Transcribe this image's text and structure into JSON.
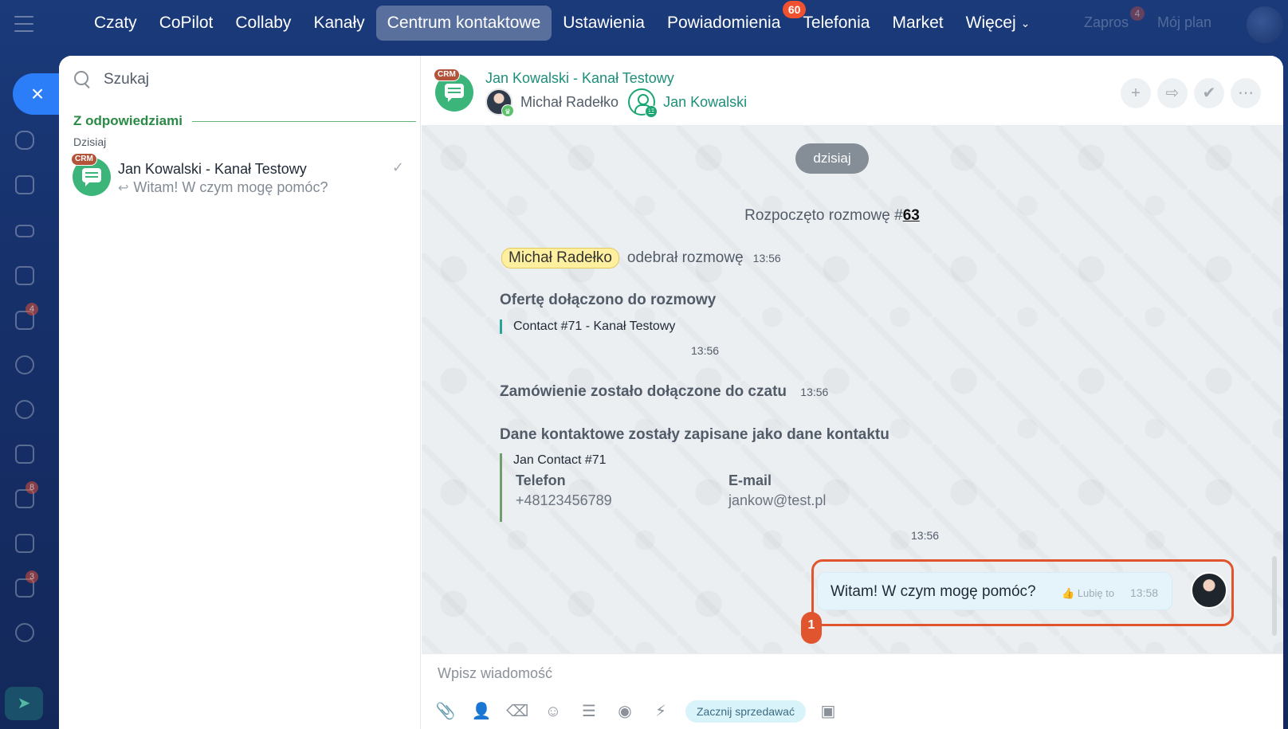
{
  "topnav": {
    "items": [
      {
        "label": "Czaty"
      },
      {
        "label": "CoPilot"
      },
      {
        "label": "Collaby"
      },
      {
        "label": "Kanały"
      },
      {
        "label": "Centrum kontaktowe"
      },
      {
        "label": "Ustawienia"
      },
      {
        "label": "Powiadomienia",
        "badge": "60"
      },
      {
        "label": "Telefonia"
      },
      {
        "label": "Market"
      },
      {
        "label": "Więcej"
      }
    ],
    "ghost_right": [
      "Zapros",
      "Mój plan"
    ],
    "ghost_badge": "4"
  },
  "rail": {
    "close_label": "×",
    "badges": [
      "4",
      "8",
      "3"
    ]
  },
  "left_panel": {
    "search_placeholder": "Szukaj",
    "section": "Z odpowiedziami",
    "day": "Dzisiaj",
    "recent": {
      "crm_tag": "CRM",
      "title": "Jan Kowalski - Kanał Testowy",
      "preview": "Witam! W czym mogę pomóc?"
    }
  },
  "chat": {
    "crm_tag": "CRM",
    "title": "Jan Kowalski - Kanał Testowy",
    "participants": [
      "Michał Radełko",
      "Jan Kowalski"
    ],
    "date_pill": "dzisiaj",
    "started_text": "Rozpoczęto rozmowę #",
    "started_num": "63",
    "accept": {
      "user": "Michał Radełko",
      "text": "odebrał rozmowę",
      "time": "13:56"
    },
    "offer": {
      "title": "Ofertę dołączono do rozmowy",
      "quote": "Contact #71 - Kanał Testowy",
      "time": "13:56"
    },
    "order": {
      "title": "Zamówienie zostało dołączone do czatu",
      "time": "13:56"
    },
    "contact": {
      "title": "Dane kontaktowe zostały zapisane jako dane kontaktu",
      "name": "Jan Contact #71",
      "phone_label": "Telefon",
      "phone": "+48123456789",
      "email_label": "E-mail",
      "email": "jankow@test.pl",
      "time": "13:56"
    },
    "message": {
      "text": "Witam! W czym mogę pomóc?",
      "like": "Lubię to",
      "time": "13:58"
    },
    "marker": "1",
    "composer_placeholder": "Wpisz wiadomość",
    "sell_button": "Zacznij sprzedawać"
  },
  "colors": {
    "accent_green": "#1d8f7a",
    "highlight": "#e0542e",
    "nav_active": "#4a5f8c"
  }
}
